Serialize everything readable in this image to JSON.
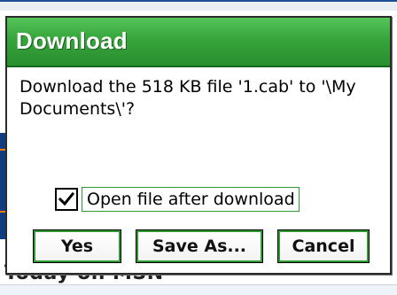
{
  "background": {
    "footer_text": "Today on MSN"
  },
  "dialog": {
    "title": "Download",
    "message": "Download the 518 KB file '1.cab' to '\\My Documents\\'?",
    "checkbox": {
      "label": "Open file after download",
      "checked": true
    },
    "buttons": {
      "yes": "Yes",
      "save_as": "Save As...",
      "cancel": "Cancel"
    }
  },
  "colors": {
    "title_bar": "#36a43b",
    "focus_border": "#2e9a31"
  }
}
